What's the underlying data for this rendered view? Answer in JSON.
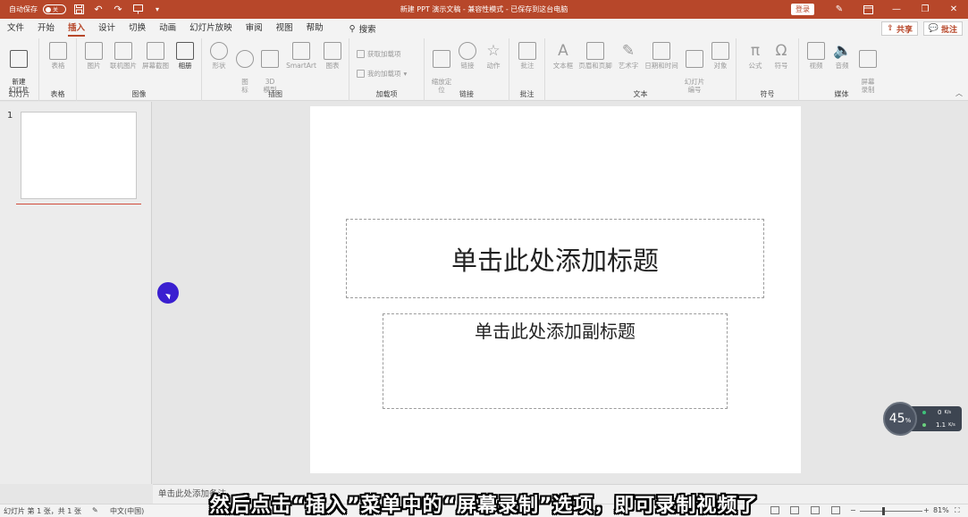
{
  "titlebar": {
    "autosave_label": "自动保存",
    "autosave_state": "关",
    "document_title": "新建 PPT 演示文稿  -  兼容性模式  -  已保存到这台电脑",
    "login_label": "登录"
  },
  "menu": {
    "tabs": [
      "文件",
      "开始",
      "插入",
      "设计",
      "切换",
      "动画",
      "幻灯片放映",
      "审阅",
      "视图",
      "帮助"
    ],
    "active_tab": "插入",
    "search_label": "搜索",
    "share_label": "共享",
    "comment_label": "批注"
  },
  "ribbon": {
    "groups": {
      "slides": "幻灯片",
      "tables": "表格",
      "images": "图像",
      "illustrations": "插图",
      "addins": "加载项",
      "links": "链接",
      "comments": "批注",
      "text": "文本",
      "symbols": "符号",
      "media": "媒体"
    },
    "buttons": {
      "new_slide": "新建\n幻灯片",
      "table": "表格",
      "pictures": "图片",
      "online_pictures": "联机图片",
      "screenshot": "屏幕截图",
      "photo_album": "相册",
      "shapes": "形状",
      "icons": "图\n标",
      "3d_models": "3D\n模型",
      "smartart": "SmartArt",
      "chart": "图表",
      "get_addins": "获取加载项",
      "my_addins": "我的加载项",
      "zoom": "缩放定\n位",
      "link": "链接",
      "action": "动作",
      "comment": "批注",
      "textbox": "文本框",
      "header_footer": "页眉和页脚",
      "wordart": "艺术字",
      "date_time": "日期和时间",
      "slide_number": "幻灯片\n编号",
      "object": "对象",
      "equation": "公式",
      "symbol": "符号",
      "video": "视频",
      "audio": "音频",
      "screen_recording": "屏幕\n录制"
    }
  },
  "slides_pane": {
    "slide_number": "1"
  },
  "slide": {
    "title_placeholder": "单击此处添加标题",
    "subtitle_placeholder": "单击此处添加副标题"
  },
  "notes": {
    "placeholder": "单击此处添加备注"
  },
  "speed_widget": {
    "percent": "45",
    "percent_unit": "%",
    "upload": "0",
    "upload_unit": "K/s",
    "download": "1.1",
    "download_unit": "K/s"
  },
  "statusbar": {
    "slide_info": "幻灯片 第 1 张，共 1 张",
    "language": "中文(中国)",
    "zoom_percent": "81%"
  },
  "caption": "然后点击“插入”菜单中的“屏幕录制”选项，即可录制视频了",
  "colors": {
    "accent": "#b7472a",
    "cursor": "#3a1fd0"
  }
}
